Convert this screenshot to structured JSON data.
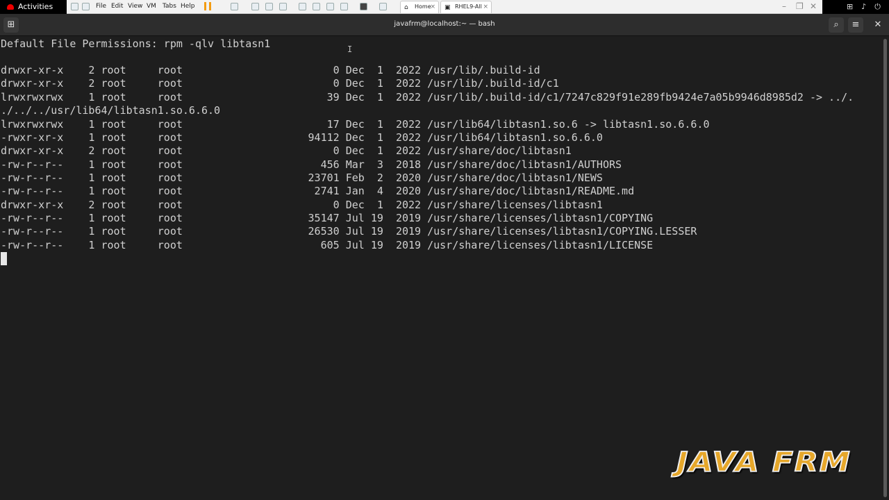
{
  "gnome": {
    "activities": "Activities"
  },
  "vmware": {
    "menu": [
      "File",
      "Edit",
      "View",
      "VM",
      "Tabs",
      "Help"
    ],
    "tabs": [
      {
        "label": "Home"
      },
      {
        "label": "RHEL9-All"
      }
    ]
  },
  "terminal": {
    "title": "javafrm@localhost:~ — bash",
    "lines": [
      "Default File Permissions: rpm -qlv libtasn1",
      "",
      "drwxr-xr-x    2 root     root                        0 Dec  1  2022 /usr/lib/.build-id",
      "drwxr-xr-x    2 root     root                        0 Dec  1  2022 /usr/lib/.build-id/c1",
      "lrwxrwxrwx    1 root     root                       39 Dec  1  2022 /usr/lib/.build-id/c1/7247c829f91e289fb9424e7a05b9946d8985d2 -> ../.",
      "./../../usr/lib64/libtasn1.so.6.6.0",
      "lrwxrwxrwx    1 root     root                       17 Dec  1  2022 /usr/lib64/libtasn1.so.6 -> libtasn1.so.6.6.0",
      "-rwxr-xr-x    1 root     root                    94112 Dec  1  2022 /usr/lib64/libtasn1.so.6.6.0",
      "drwxr-xr-x    2 root     root                        0 Dec  1  2022 /usr/share/doc/libtasn1",
      "-rw-r--r--    1 root     root                      456 Mar  3  2018 /usr/share/doc/libtasn1/AUTHORS",
      "-rw-r--r--    1 root     root                    23701 Feb  2  2020 /usr/share/doc/libtasn1/NEWS",
      "-rw-r--r--    1 root     root                     2741 Jan  4  2020 /usr/share/doc/libtasn1/README.md",
      "drwxr-xr-x    2 root     root                        0 Dec  1  2022 /usr/share/licenses/libtasn1",
      "-rw-r--r--    1 root     root                    35147 Jul 19  2019 /usr/share/licenses/libtasn1/COPYING",
      "-rw-r--r--    1 root     root                    26530 Jul 19  2019 /usr/share/licenses/libtasn1/COPYING.LESSER",
      "-rw-r--r--    1 root     root                      605 Jul 19  2019 /usr/share/licenses/libtasn1/LICENSE"
    ]
  },
  "watermark": "JAVA FRM"
}
